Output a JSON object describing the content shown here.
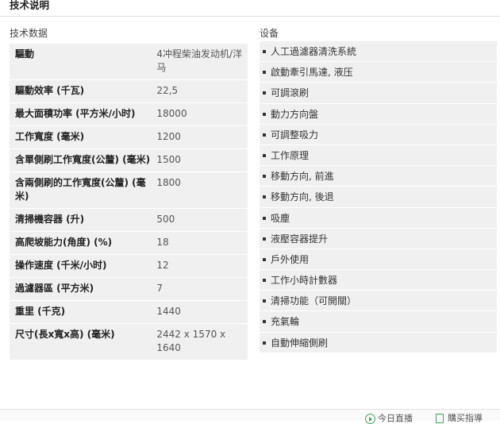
{
  "section_title": "技术说明",
  "specs": {
    "heading": "技术数据",
    "rows": [
      {
        "label": "驅動",
        "value": "4冲程柴油发动机/洋马"
      },
      {
        "label": "驅動效率 (千瓦)",
        "value": "22,5"
      },
      {
        "label": "最大面積功率 (平方米/小时)",
        "value": "18000"
      },
      {
        "label": "工作寬度 (毫米)",
        "value": "1200"
      },
      {
        "label": "含單側刷工作寬度(公釐) (毫米)",
        "value": "1500"
      },
      {
        "label": "含兩側刷的工作寬度(公釐) (毫米)",
        "value": "1800"
      },
      {
        "label": "清掃機容器 (升)",
        "value": "500"
      },
      {
        "label": "高爬坡能力(角度) (%)",
        "value": "18"
      },
      {
        "label": "操作速度 (千米/小时)",
        "value": "12"
      },
      {
        "label": "過濾器區 (平方米)",
        "value": "7"
      },
      {
        "label": "重里 (千克)",
        "value": "1440"
      },
      {
        "label": "尺寸(長x寬x高) (毫米)",
        "value": "2442 x 1570 x 1640"
      }
    ]
  },
  "equipment": {
    "heading": "设备",
    "items": [
      "人工過濾器清洗系統",
      "啟動牽引馬達, 液压",
      "可調滾刷",
      "動力方向盤",
      "可調整吸力",
      "工作原理",
      "移動方向, 前進",
      "移動方向, 後退",
      "吸塵",
      "液壓容器提升",
      "戶外使用",
      "工作小時計數器",
      "清掃功能（可開關）",
      "充氣輪",
      "自動伸縮側刷"
    ]
  },
  "footer": {
    "live_label": "今日直播",
    "guide_label": "購买指導"
  }
}
